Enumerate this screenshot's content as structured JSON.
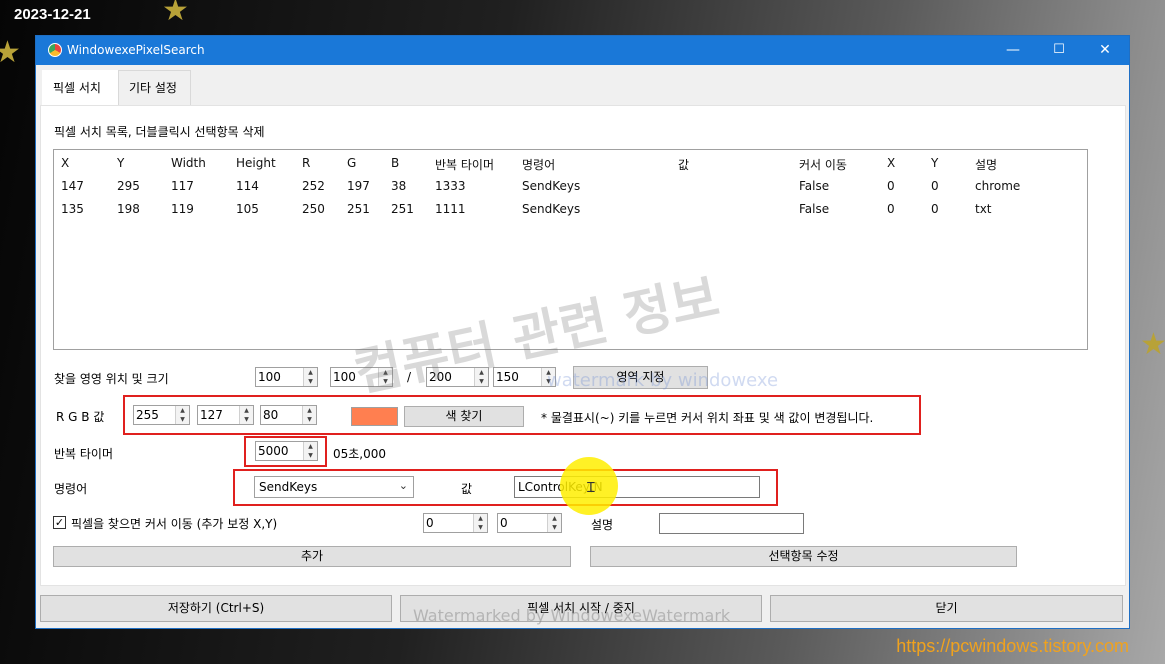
{
  "overlay": {
    "date": "2023-12-21",
    "site_url": "https://pcwindows.tistory.com",
    "watermark_main": "컴퓨터 관련 정보",
    "watermark_sub": "watermark by windowexe",
    "watermark_bottom": "Watermarked by WindowexeWatermark"
  },
  "window": {
    "title": "WindowexePixelSearch",
    "controls": {
      "minimize": "—",
      "maximize": "☐",
      "close": "✕"
    }
  },
  "tabs": [
    {
      "label": "픽셀 서치",
      "active": true
    },
    {
      "label": "기타 설정",
      "active": false
    }
  ],
  "list": {
    "caption": "픽셀 서치 목록, 더블클릭시 선택항목 삭제",
    "columns": [
      "X",
      "Y",
      "Width",
      "Height",
      "R",
      "G",
      "B",
      "반복 타이머",
      "명령어",
      "값",
      "커서 이동",
      "X",
      "Y",
      "설명"
    ],
    "rows": [
      [
        "147",
        "295",
        "117",
        "114",
        "252",
        "197",
        "38",
        "1333",
        "SendKeys",
        "",
        "False",
        "0",
        "0",
        "chrome"
      ],
      [
        "135",
        "198",
        "119",
        "105",
        "250",
        "251",
        "251",
        "1111",
        "SendKeys",
        "",
        "False",
        "0",
        "0",
        "txt"
      ]
    ]
  },
  "area": {
    "label": "찾을 영영 위치 및 크기",
    "x": "100",
    "y": "100",
    "separator": "/",
    "width": "200",
    "height": "150",
    "set_button": "영역 지정"
  },
  "rgb": {
    "label": "R G B 값",
    "r": "255",
    "g": "127",
    "b": "80",
    "color_hex": "#ff7f50",
    "find_button": "색 찾기",
    "hint": "* 물결표시(~) 키를 누르면 커서 위치 좌표 및 색 값이 변경됩니다."
  },
  "timer": {
    "label": "반복 타이머",
    "value": "5000",
    "display": "05초,000"
  },
  "command": {
    "label": "명령어",
    "selected": "SendKeys",
    "value_label": "값",
    "value": "LControlKey,N"
  },
  "cursor": {
    "checkbox_label": "픽셀을 찾으면 커서 이동 (추가 보정 X,Y)",
    "checked": true,
    "x": "0",
    "y": "0",
    "desc_label": "설명",
    "desc_value": ""
  },
  "actions": {
    "add": "추가",
    "edit_selected": "선택항목 수정"
  },
  "footer": {
    "save": "저장하기 (Ctrl+S)",
    "start_stop": "픽셀 서치 시작 / 중지",
    "close": "닫기"
  },
  "colors": {
    "title_bar": "#1a78d8",
    "highlight_box": "#e0201e",
    "site_url": "#f0a21e",
    "swatch": "#ff7f50"
  }
}
